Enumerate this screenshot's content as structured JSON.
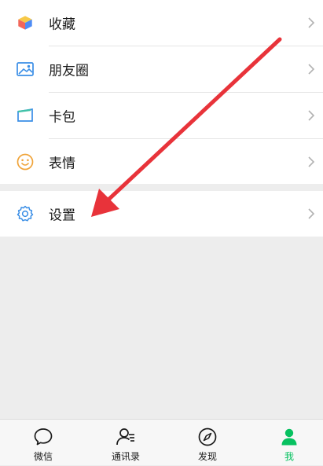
{
  "menu": {
    "group1": [
      {
        "label": "收藏",
        "icon": "favorites-cube-icon"
      },
      {
        "label": "朋友圈",
        "icon": "moments-picture-icon"
      },
      {
        "label": "卡包",
        "icon": "card-wallet-icon"
      },
      {
        "label": "表情",
        "icon": "sticker-smiley-icon"
      }
    ],
    "group2": [
      {
        "label": "设置",
        "icon": "settings-gear-icon"
      }
    ]
  },
  "tabbar": {
    "items": [
      {
        "label": "微信",
        "icon": "chat-bubble-icon",
        "active": false
      },
      {
        "label": "通讯录",
        "icon": "contacts-person-icon",
        "active": false
      },
      {
        "label": "发现",
        "icon": "discover-compass-icon",
        "active": false
      },
      {
        "label": "我",
        "icon": "me-person-icon",
        "active": true
      }
    ]
  },
  "colors": {
    "accent": "#07c160",
    "annotation_arrow": "#e8333a",
    "page_background": "#ededed"
  }
}
